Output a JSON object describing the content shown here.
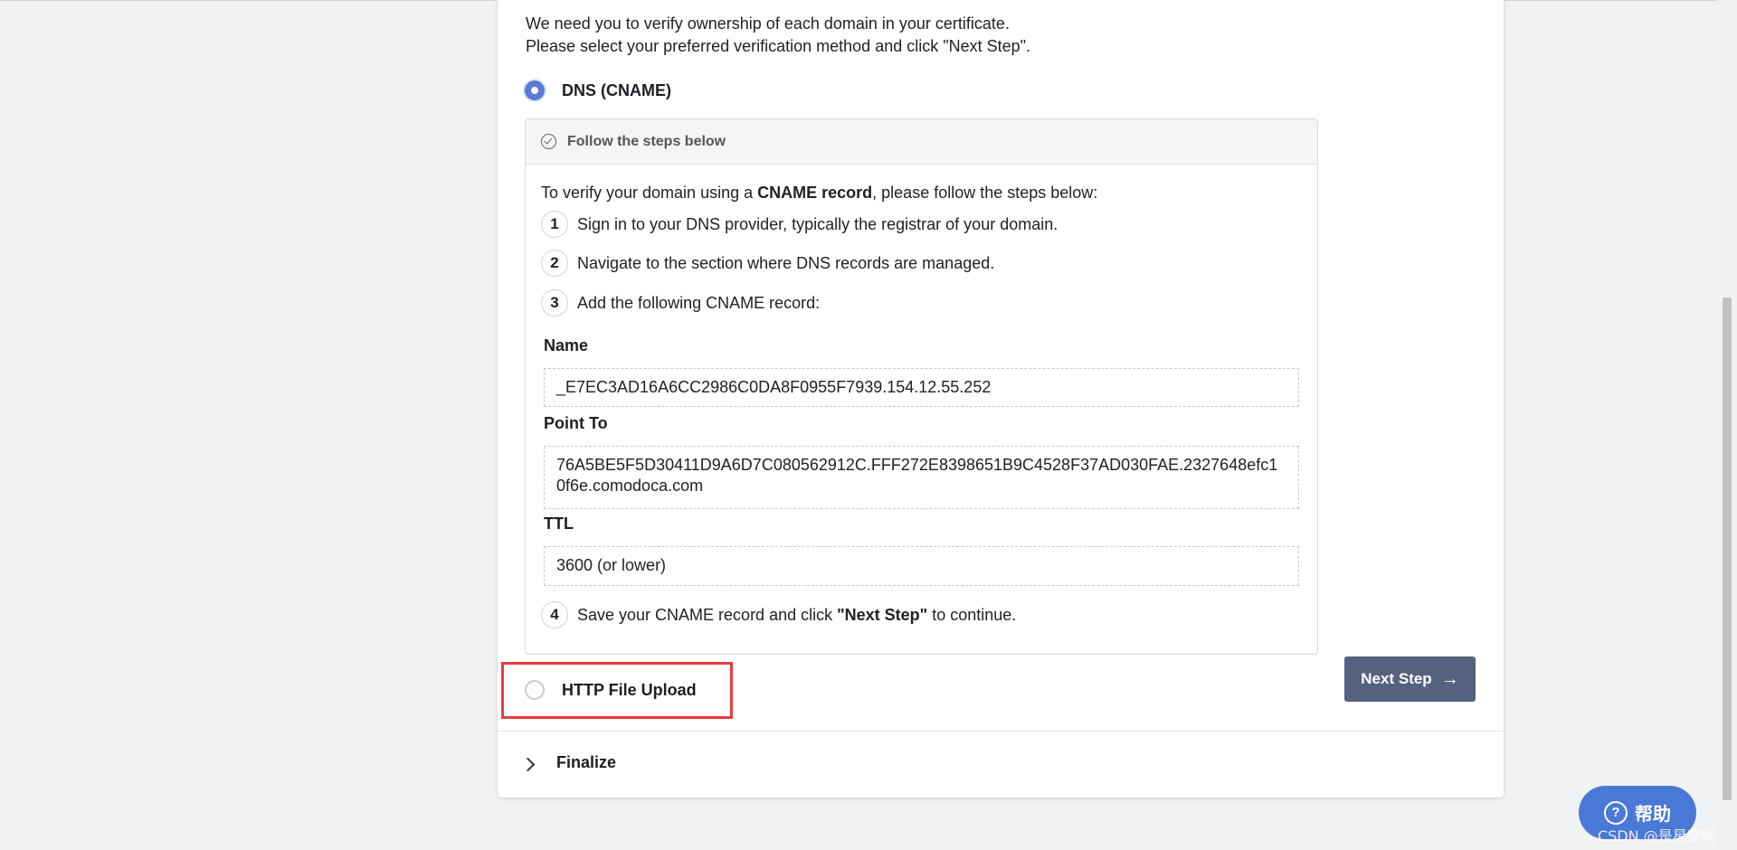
{
  "intro": {
    "line1": "We need you to verify ownership of each domain in your certificate.",
    "line2": "Please select your preferred verification method and click \"Next Step\"."
  },
  "methods": {
    "dns_label": "DNS (CNAME)",
    "dns_checked": true,
    "http_label": "HTTP File Upload",
    "http_checked": false
  },
  "panel": {
    "header": "Follow the steps below",
    "intro_pre": "To verify your domain using a ",
    "intro_bold": "CNAME record",
    "intro_post": ", please follow the steps below:",
    "steps": [
      {
        "num": "1",
        "text": "Sign in to your DNS provider, typically the registrar of your domain."
      },
      {
        "num": "2",
        "text": "Navigate to the section where DNS records are managed."
      },
      {
        "num": "3",
        "text": "Add the following CNAME record:"
      },
      {
        "num": "4",
        "text_pre": "Save your CNAME record and click ",
        "text_bold": "\"Next Step\"",
        "text_post": " to continue."
      }
    ],
    "fields": {
      "name_label": "Name",
      "name_value": "_E7EC3AD16A6CC2986C0DA8F0955F7939.154.12.55.252",
      "point_label": "Point To",
      "point_value": "76A5BE5F5D30411D9A6D7C080562912C.FFF272E8398651B9C4528F37AD030FAE.2327648efc10f6e.comodoca.com",
      "ttl_label": "TTL",
      "ttl_value": "3600 (or lower)"
    }
  },
  "next_button": {
    "label": "Next Step",
    "icon": "arrow-right-icon"
  },
  "finalize": {
    "label": "Finalize",
    "icon": "chevron-right-icon"
  },
  "help": {
    "label": "帮助",
    "icon": "question-circle-icon"
  },
  "watermark": "CSDN @是星空鸭",
  "colors": {
    "accent": "#5a7bd8",
    "button": "#55627f",
    "highlight_border": "#ea3a3d",
    "help_button": "#4a78d6"
  }
}
